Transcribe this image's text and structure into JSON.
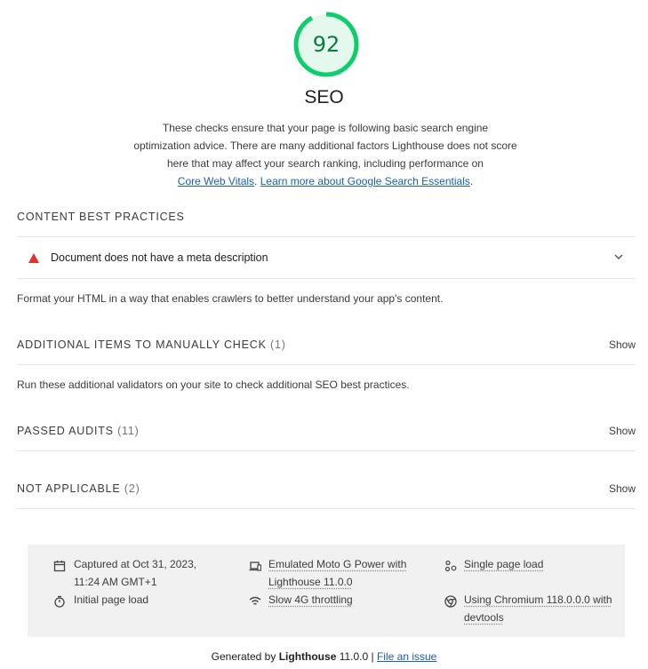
{
  "score": {
    "value": "92",
    "fraction": 0.92,
    "color": "#0cce6b"
  },
  "category": {
    "title": "SEO",
    "description": "These checks ensure that your page is following basic search engine optimization advice. There are many additional factors Lighthouse does not score here that may affect your search ranking, including performance on",
    "link1": "Core Web Vitals",
    "sep": ". ",
    "link2": "Learn more about Google Search Essentials",
    "end": "."
  },
  "groups": {
    "content": {
      "title": "Content Best Practices",
      "audit": "Document does not have a meta description",
      "description": "Format your HTML in a way that enables crawlers to better understand your app's content."
    },
    "manual": {
      "title": "Additional items to manually check",
      "count": "(1)",
      "show": "Show",
      "description": "Run these additional validators on your site to check additional SEO best practices."
    },
    "passed": {
      "title": "Passed audits",
      "count": "(11)",
      "show": "Show"
    },
    "notapplicable": {
      "title": "Not applicable",
      "count": "(2)",
      "show": "Show"
    }
  },
  "environment": {
    "captured": "Captured at Oct 31, 2023, 11:24 AM GMT+1",
    "initial": "Initial page load",
    "device": "Emulated Moto G Power with Lighthouse 11.0.0",
    "throttling": "Slow 4G throttling",
    "single": "Single page load",
    "browser": "Using Chromium 118.0.0.0 with devtools"
  },
  "footer": {
    "prefix": "Generated by ",
    "brand": "Lighthouse",
    "version": " 11.0.0 | ",
    "link": "File an issue"
  },
  "icons": {
    "gauge": "score-gauge-icon",
    "fail": "warning-triangle-icon",
    "chevron": "chevron-down-icon",
    "calendar": "calendar-icon",
    "timer": "stopwatch-icon",
    "device": "devices-icon",
    "network": "wifi-icon",
    "session": "network-nodes-icon",
    "browser": "chrome-icon"
  },
  "colors": {
    "pass": "#0cce6b",
    "fail": "#e0332b",
    "link": "#1a5fb4"
  }
}
